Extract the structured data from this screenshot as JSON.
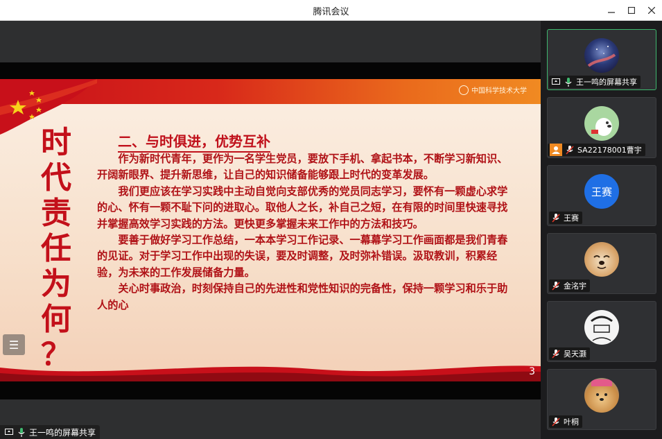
{
  "window": {
    "title": "腾讯会议"
  },
  "slide": {
    "vertical_title": [
      "时",
      "代",
      "责",
      "任",
      "为",
      "何",
      "？"
    ],
    "heading": "二、与时俱进，优势互补",
    "paragraphs": [
      "作为新时代青年，更作为一名学生党员，要放下手机、拿起书本，不断学习新知识、开阔新眼界、提升新思维，让自己的知识储备能够跟上时代的变革发展。",
      "我们更应该在学习实践中主动自觉向支部优秀的党员同志学习，要怀有一颗虚心求学的心、怀有一颗不耻下问的进取心。取他人之长，补自己之短，在有限的时间里快速寻找并掌握高效学习实践的方法。更快更多掌握未来工作中的方法和技巧。",
      "要善于做好学习工作总结，一本本学习工作记录、一幕幕学习工作画面都是我们青春的见证。对于学习工作中出现的失误，要及时调整，及时弥补错误。汲取教训，积累经验，为未来的工作发展储备力量。",
      "关心时事政治，时刻保持自己的先进性和党性知识的完备性，保持一颗学习和乐于助人的心"
    ],
    "page_number": "3",
    "logo_text": "中国科学技术大学"
  },
  "share_label": "王一鸣的屏幕共享",
  "participants": [
    {
      "name": "王一鸣的屏幕共享",
      "avatar": "galaxy",
      "mic": "on",
      "icon": "screen-share-icon",
      "active": true
    },
    {
      "name": "SA22178001曹宇",
      "avatar": "cartoon-dog",
      "mic": "muted",
      "icon": "user-badge-icon",
      "active": false
    },
    {
      "name": "王赛",
      "avatar": "text",
      "avatar_text": "王赛",
      "mic": "muted",
      "active": false
    },
    {
      "name": "金洺宇",
      "avatar": "shiba",
      "mic": "muted",
      "active": false
    },
    {
      "name": "吴天灏",
      "avatar": "sketch",
      "mic": "muted",
      "active": false
    },
    {
      "name": "叶桐",
      "avatar": "dog-photo",
      "mic": "muted",
      "active": false
    }
  ],
  "colors": {
    "accent_green": "#3fb86f",
    "slide_red": "#c0101b",
    "avatar_blue": "#1f6fe5"
  }
}
